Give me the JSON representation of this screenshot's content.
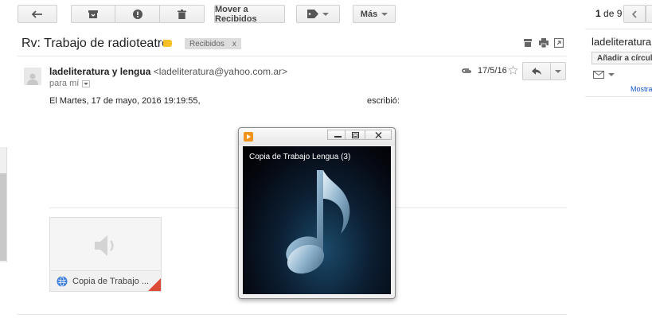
{
  "toolbar": {
    "move_label": "Mover a Recibidos",
    "more_label": "Más"
  },
  "pager": {
    "current": "1",
    "of": "de",
    "total": "9"
  },
  "email": {
    "subject": "Rv: Trabajo de radioteatro",
    "label_chip": "Recibidos",
    "label_chip_close": "x",
    "sender_name": "ladeliteratura y lengua",
    "sender_email": "<ladeliteratura@yahoo.com.ar>",
    "to_label": "para mí",
    "date": "17/5/16",
    "quote_prefix": "El Martes, 17 de mayo, 2016 19:19:55,",
    "quote_suffix": "escribió:"
  },
  "right_panel": {
    "name": "ladeliteratura",
    "add_button": "Añadir a círculos",
    "more_link": "Mostrar"
  },
  "attachment": {
    "file_name": "Copia de Trabajo ..."
  },
  "player": {
    "title": "Copia de Trabajo Lengua (3)"
  },
  "colors": {
    "accent_red": "#dd4b39",
    "label_yellow": "#f6c026",
    "link_blue": "#1155cc"
  }
}
